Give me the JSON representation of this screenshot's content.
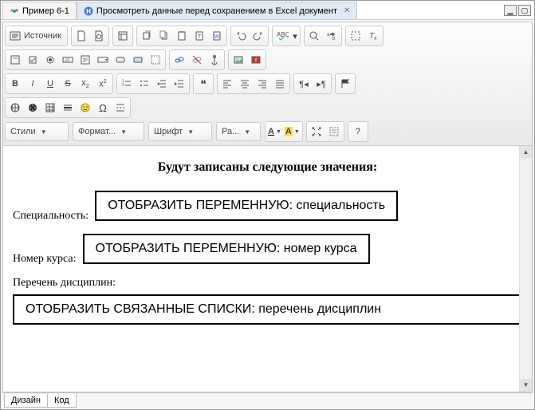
{
  "tabs": {
    "t0": "Пример 6-1",
    "t1": "Просмотреть данные перед сохранением в Excel документ"
  },
  "toolbar": {
    "source_label": "Источник"
  },
  "combos": {
    "styles": "Стили",
    "format": "Формат...",
    "font": "Шрифт",
    "size": "Ра...",
    "textcolor": "A",
    "bgcolor": "A"
  },
  "content": {
    "title": "Будут записаны следующие значения:",
    "label_speciality": "Специальность:",
    "label_course": "Номер курса:",
    "label_subjects": "Перечень дисциплин:",
    "var_speciality": "ОТОБРАЗИТЬ ПЕРЕМЕННУЮ: специальность",
    "var_course": "ОТОБРАЗИТЬ ПЕРЕМЕННУЮ: номер курса",
    "var_subjects": "ОТОБРАЗИТЬ СВЯЗАННЫЕ СПИСКИ: перечень дисциплин"
  },
  "bottom_tabs": {
    "design": "Дизайн",
    "code": "Код"
  },
  "glyphs": {
    "question": "?"
  }
}
